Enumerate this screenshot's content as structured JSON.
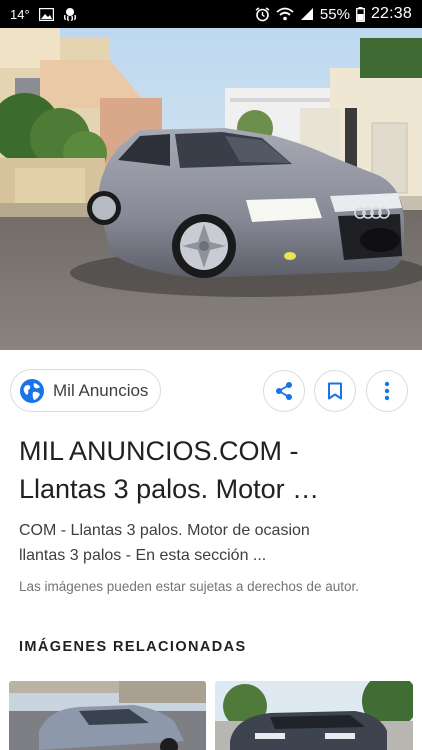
{
  "status_bar": {
    "temperature": "14°",
    "battery": "55%",
    "time": "22:38",
    "icons": [
      "image-icon",
      "octopus-icon",
      "alarm-icon",
      "wifi-icon",
      "signal-icon",
      "battery-icon"
    ]
  },
  "hero": {
    "alt": "Audi A6 Avant gris aparcado en la calle"
  },
  "source": {
    "label": "Mil Anuncios",
    "icon": "globe-icon"
  },
  "actions": {
    "share_icon": "share-icon",
    "save_icon": "bookmark-icon",
    "more_icon": "more-vert-icon"
  },
  "result": {
    "title_line1": "MIL ANUNCIOS.COM -",
    "title_line2": "Llantas 3 palos. Motor …",
    "desc_line1": "COM - Llantas 3 palos. Motor de ocasion",
    "desc_line2": "llantas 3 palos - En esta sección ...",
    "copyright": "Las imágenes pueden estar sujetas a derechos de autor."
  },
  "related": {
    "header": "IMÁGENES RELACIONADAS"
  },
  "colors": {
    "accent_blue": "#1a73e8",
    "status_bar_bg": "#000000",
    "chip_border": "#dadce0"
  }
}
